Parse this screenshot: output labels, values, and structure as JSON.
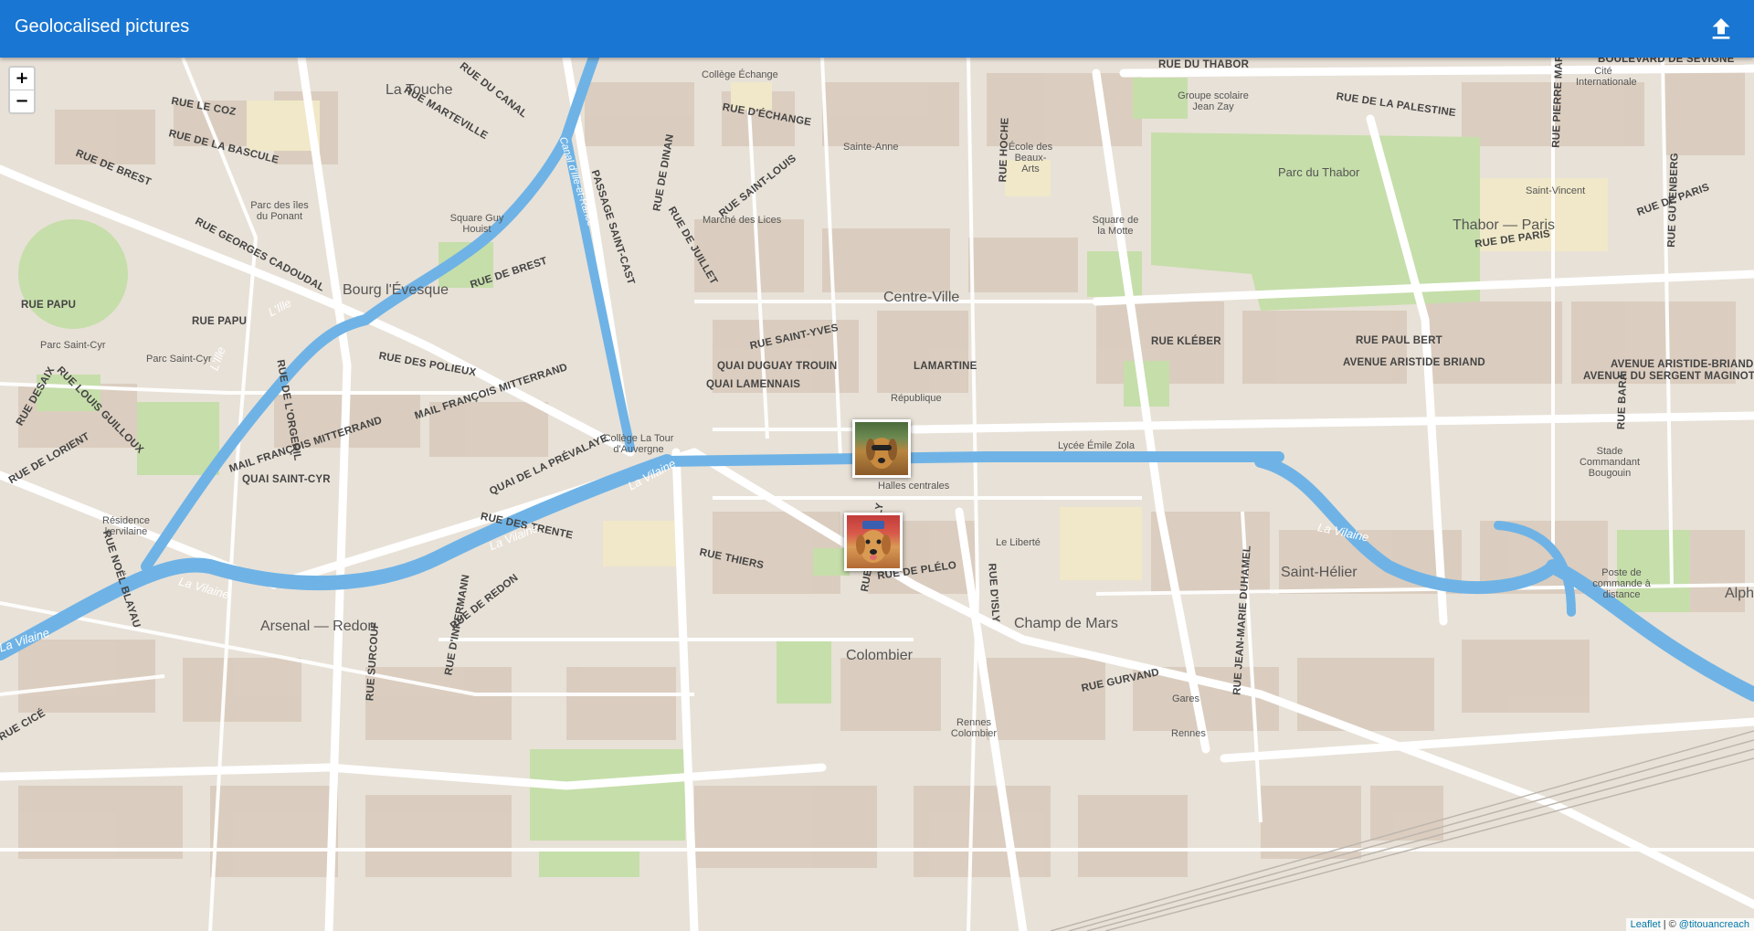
{
  "app": {
    "title": "Geolocalised pictures",
    "upload_icon": "upload-icon"
  },
  "map": {
    "zoom_in": "+",
    "zoom_out": "−",
    "attribution": {
      "leaflet": "Leaflet",
      "separator": " | © ",
      "author": "@titouancreach"
    },
    "markers": [
      {
        "name": "dog-photo-marker-1",
        "alt": "dog in sunglasses"
      },
      {
        "name": "dog-photo-marker-2",
        "alt": "golden retriever"
      }
    ],
    "labels": {
      "districts": [
        "La Touche",
        "Bourg l'Évesque",
        "Centre-Ville",
        "Thabor — Paris",
        "Arsenal — Redon",
        "Colombier",
        "Champ de Mars",
        "Saint-Hélier",
        "Alph"
      ],
      "pois": [
        "Collège Échange",
        "Sainte-Anne",
        "École des Beaux-Arts",
        "Groupe scolaire Jean Zay",
        "Cité Internationale",
        "Parc du Thabor",
        "Saint-Vincent",
        "Square de la Motte",
        "Marché des Lices",
        "Parc des îles du Ponant",
        "Square Guy Houist",
        "Parc Saint-Cyr",
        "Parc Saint-Cyr",
        "République",
        "Collège La Tour d'Auvergne",
        "Lycée Émile Zola",
        "Halles centrales",
        "Stade Commandant Bougouin",
        "Résidence kervilaine",
        "Le Liberté",
        "Poste de commande à distance",
        "Gares",
        "Rennes",
        "Rennes Colombier"
      ],
      "streets": [
        "RUE DU THABOR",
        "BOULEVARD DE SÉVIGNÉ",
        "RUE DE LA PALESTINE",
        "RUE D'ÉCHANGE",
        "RUE HOCHE",
        "RUE DE DINAN",
        "RUE SAINT-LOUIS",
        "PASSAGE SAINT-CAST",
        "RUE DE JUILLET",
        "RUE DE BREST",
        "RUE DE BREST",
        "RUE LE COZ",
        "RUE DE LA BASCULE",
        "RUE DU CANAL",
        "RUE MARTEVILLE",
        "RUE GEORGES CADOUDAL",
        "RUE PAPU",
        "RUE PAPU",
        "RUE DES POLIEUX",
        "MAIL FRANÇOIS MITTERRAND",
        "MAIL FRANÇOIS MITTERRAND",
        "RUE SAINT-YVES",
        "QUAI DUGUAY TROUIN",
        "QUAI LAMENNAIS",
        "LAMARTINE",
        "RUE KLÉBER",
        "RUE PAUL BERT",
        "AVENUE ARISTIDE BRIAND",
        "AVENUE ARISTIDE-BRIAND",
        "AVENUE DU SERGENT MAGINOT",
        "RUE DE PARIS",
        "RUE DE PARIS",
        "QUAI SAINT-CYR",
        "QUAI DE LA PRÉVALAYE",
        "RUE DE LORIENT",
        "RUE LOUIS GUILLOUX",
        "RUE DESAIX",
        "RUE DES TRENTE",
        "RUE THIERS",
        "RUE TRONJOLLY",
        "RUE DE PLÉLO",
        "RUE D'ISLY",
        "RUE DE REDON",
        "RUE D'INKERMANN",
        "RUE SURCOUF",
        "RUE GURVAND",
        "RUE JEAN-MARIE DUHAMEL",
        "RUE NOËL BLAYAU",
        "RUE CICÉ",
        "RUE DE L'ORGERIL",
        "RUE GUTENBERG",
        "RUE BARA",
        "RUE PIERRE MARTIN"
      ],
      "water": [
        "La Vilaine",
        "La Vilaine",
        "La Vilaine",
        "La Vilaine",
        "La Vilaine",
        "L'Ille",
        "L'Ille",
        "Canal d'Ille-et-Rance"
      ]
    }
  }
}
